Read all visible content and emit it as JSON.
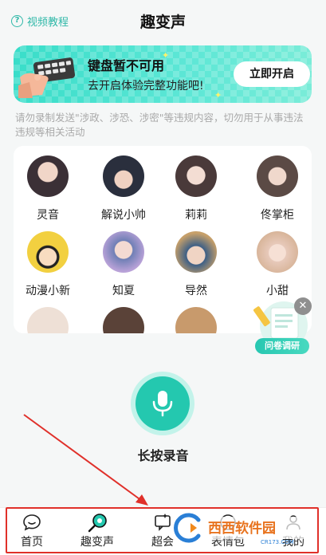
{
  "header": {
    "tutorial_label": "视频教程",
    "title": "趣变声"
  },
  "banner": {
    "title": "键盘暂不可用",
    "subtitle": "去开启体验完整功能吧!",
    "button_label": "立即开启"
  },
  "notice": "请勿录制发送\"涉政、涉恐、涉密\"等违规内容，切勿用于从事违法违规等相关活动",
  "voices": [
    {
      "name": "灵音",
      "avatar_color": "#3b3036"
    },
    {
      "name": "解说小帅",
      "avatar_color": "#2a2f3d"
    },
    {
      "name": "莉莉",
      "avatar_color": "#4a3a3a"
    },
    {
      "name": "佟掌柜",
      "avatar_color": "#5b4a45"
    },
    {
      "name": "动漫小新",
      "avatar_color": "#f2d040"
    },
    {
      "name": "知夏",
      "avatar_color": "#6f7fb5"
    },
    {
      "name": "导然",
      "avatar_color": "#3d5f86"
    },
    {
      "name": "小甜",
      "avatar_color": "#e7c9ba"
    }
  ],
  "survey": {
    "label": "问卷调研",
    "close_icon": "close-icon"
  },
  "record": {
    "label": "长按录音",
    "icon": "microphone-icon"
  },
  "nav": [
    {
      "label": "首页",
      "icon": "chat-bubble-icon"
    },
    {
      "label": "趣变声",
      "icon": "voice-changer-icon",
      "active": true
    },
    {
      "label": "超会",
      "icon": "message-icon"
    },
    {
      "label": "表情包",
      "icon": "emoji-icon"
    },
    {
      "label": "我的",
      "icon": "user-icon"
    }
  ],
  "watermark": {
    "text": "西西软件园",
    "subtext": "CR173.COM"
  },
  "colors": {
    "accent": "#24c8af",
    "annotation": "#e0302a"
  }
}
